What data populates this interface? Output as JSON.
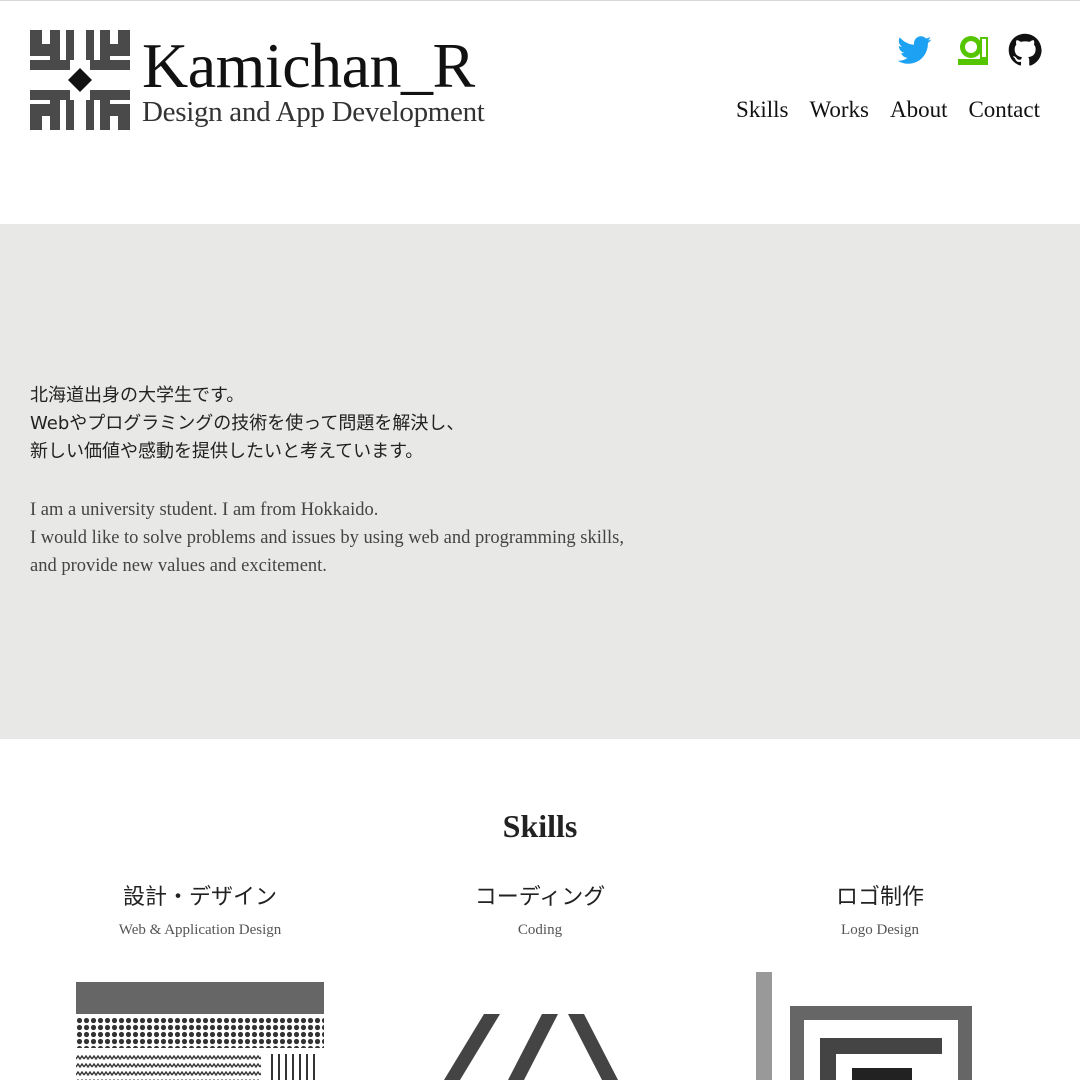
{
  "header": {
    "brand_title": "Kamichan_R",
    "brand_subtitle": "Design and App Development",
    "logo_icon": "kamichan-logo-mark",
    "social": [
      {
        "name": "twitter-icon",
        "color": "#1da1f2"
      },
      {
        "name": "qiita-icon",
        "color": "#55c500"
      },
      {
        "name": "github-icon",
        "color": "#111111"
      }
    ],
    "nav": [
      "Skills",
      "Works",
      "About",
      "Contact"
    ]
  },
  "hero": {
    "jp_lines": [
      "北海道出身の大学生です。",
      "Webやプログラミングの技術を使って問題を解決し、",
      "新しい価値や感動を提供したいと考えています。"
    ],
    "en_lines": [
      "I am a university student. I am from Hokkaido.",
      "I would like to solve problems and issues by using web and programming skills,",
      "and provide new values and excitement."
    ],
    "background": "#e8e8e6"
  },
  "skills": {
    "title": "Skills",
    "items": [
      {
        "jp": "設計・デザイン",
        "en": "Web & Application Design",
        "image_icon": "design-illustration"
      },
      {
        "jp": "コーディング",
        "en": "Coding",
        "image_icon": "coding-brackets-illustration"
      },
      {
        "jp": "ロゴ制作",
        "en": "Logo Design",
        "image_icon": "logo-design-illustration"
      }
    ]
  }
}
